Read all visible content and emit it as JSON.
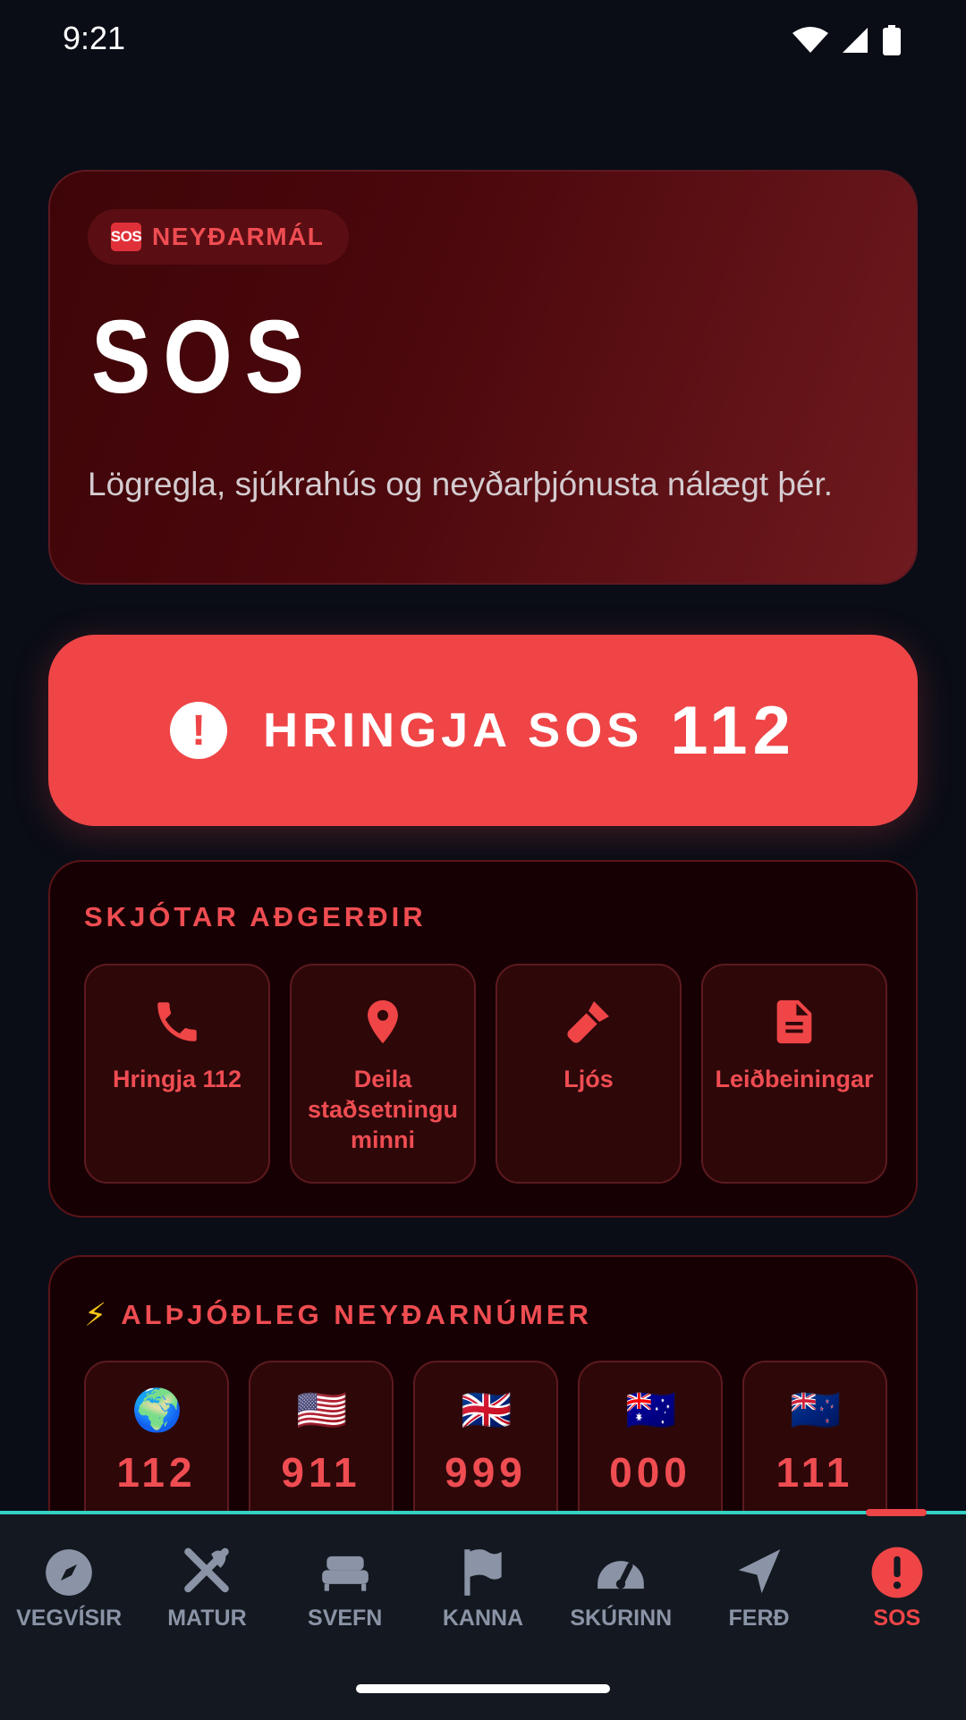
{
  "status_bar": {
    "time": "9:21"
  },
  "hero": {
    "badge_icon": "sos-emoji",
    "badge_icon_text": "SOS",
    "badge": "NEYÐARMÁL",
    "title": "SOS",
    "description": "Lögregla, sjúkrahús og neyðarþjónusta nálægt þér."
  },
  "call_button": {
    "icon": "exclamation-circle-icon",
    "label": "HRINGJA SOS",
    "number": "112"
  },
  "quick_actions": {
    "title": "SKJÓTAR AÐGERÐIR",
    "items": [
      {
        "icon": "phone-icon",
        "label": "Hringja 112"
      },
      {
        "icon": "map-pin-icon",
        "label": "Deila staðsetningu minni"
      },
      {
        "icon": "flashlight-icon",
        "label": "Ljós"
      },
      {
        "icon": "document-icon",
        "label": "Leiðbeiningar"
      }
    ]
  },
  "international": {
    "title_icon": "lightning-emoji",
    "title": "ALÞJÓÐLEG NEYÐARNÚMER",
    "numbers": [
      {
        "flag": "🌍",
        "number": "112"
      },
      {
        "flag": "🇺🇸",
        "number": "911"
      },
      {
        "flag": "🇬🇧",
        "number": "999"
      },
      {
        "flag": "🇦🇺",
        "number": "000"
      },
      {
        "flag": "🇳🇿",
        "number": "111"
      }
    ]
  },
  "bottom_nav": {
    "items": [
      {
        "label": "VEGVÍSIR",
        "icon": "compass-icon"
      },
      {
        "label": "MATUR",
        "icon": "utensils-icon"
      },
      {
        "label": "SVEFN",
        "icon": "bed-icon"
      },
      {
        "label": "KANNA",
        "icon": "flag-icon"
      },
      {
        "label": "SKÚRINN",
        "icon": "gauge-icon"
      },
      {
        "label": "FERÐ",
        "icon": "navigation-arrow-icon"
      },
      {
        "label": "SOS",
        "icon": "exclamation-circle-icon",
        "active": true
      }
    ]
  },
  "colors": {
    "accent": "#ef4547",
    "accent_text": "#ef4d52",
    "nav_inactive": "#8a94a6",
    "nav_border": "#34d1c4",
    "background": "#0a0d16"
  }
}
